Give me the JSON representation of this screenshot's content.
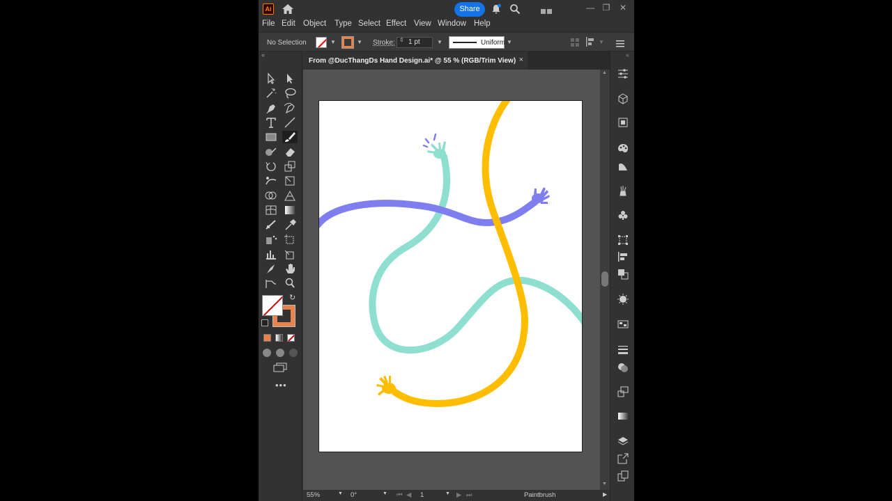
{
  "app": {
    "logo": "Ai",
    "share_label": "Share"
  },
  "menu": [
    "File",
    "Edit",
    "Object",
    "Type",
    "Select",
    "Effect",
    "View",
    "Window",
    "Help"
  ],
  "control": {
    "selection": "No Selection",
    "stroke_label": "Stroke:",
    "stroke_value": "1 pt",
    "profile": "Uniform",
    "fill_color": "none",
    "stroke_color": "#e8834d"
  },
  "document": {
    "tab_title": "From @DucThangDs Hand Design.ai* @ 55 % (RGB/Trim View)",
    "close": "×"
  },
  "status": {
    "zoom": "55%",
    "rotation": "0°",
    "artboard": "1",
    "tool": "Paintbrush"
  },
  "artwork": {
    "strands": [
      {
        "name": "purple-arm",
        "color": "#7f7ef0"
      },
      {
        "name": "teal-arm",
        "color": "#8edfd0"
      },
      {
        "name": "yellow-arm",
        "color": "#ffbd00"
      }
    ]
  },
  "icons": {
    "tools": [
      "selection-tool",
      "direct-selection-tool",
      "magic-wand-tool",
      "lasso-tool",
      "pen-tool",
      "curvature-tool",
      "type-tool",
      "line-segment-tool",
      "rectangle-tool",
      "paintbrush-tool",
      "shaper-tool",
      "eraser-tool",
      "rotate-tool",
      "scale-tool",
      "puppet-warp-tool",
      "free-transform-tool",
      "shape-builder-tool",
      "perspective-grid-tool",
      "mesh-tool",
      "gradient-tool",
      "eyedropper-tool",
      "measure-tool",
      "blend-tool",
      "symbol-sprayer-tool",
      "graph-tool",
      "artboard-tool",
      "slice-tool",
      "hand-tool",
      "zoom-tool",
      "edit-toolbar-tool"
    ]
  }
}
